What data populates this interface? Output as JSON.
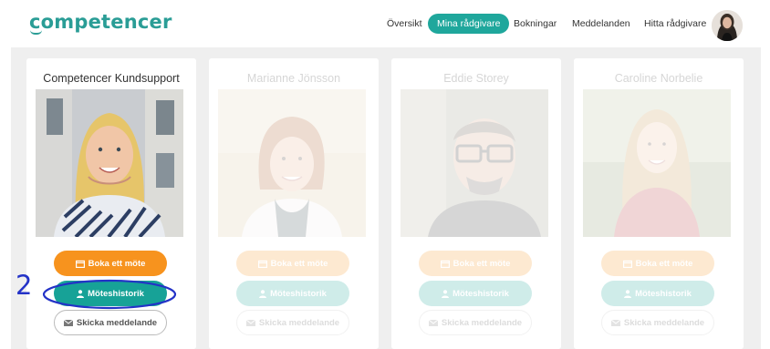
{
  "brand": {
    "logo_text": "competencer"
  },
  "nav": {
    "items": [
      {
        "label": "Översikt",
        "active": false
      },
      {
        "label": "Mina rådgivare",
        "active": true
      },
      {
        "label": "Bokningar",
        "active": false
      },
      {
        "label": "Meddelanden",
        "active": false
      },
      {
        "label": "Hitta rådgivare",
        "active": false
      }
    ]
  },
  "advisors": [
    {
      "name": "Competencer Kundsupport",
      "faded": false
    },
    {
      "name": "Marianne Jönsson",
      "faded": true
    },
    {
      "name": "Eddie Storey",
      "faded": true
    },
    {
      "name": "Caroline Norbelie",
      "faded": true
    }
  ],
  "buttons": {
    "book_label": "Boka ett möte",
    "history_label": "Möteshistorik",
    "message_label": "Skicka meddelande"
  },
  "annotation": {
    "label": "2",
    "color": "#2332c7"
  },
  "colors": {
    "brand_teal": "#2a9d96",
    "history_button": "#17a297",
    "book_button": "#f7931e",
    "background": "#efefef"
  }
}
